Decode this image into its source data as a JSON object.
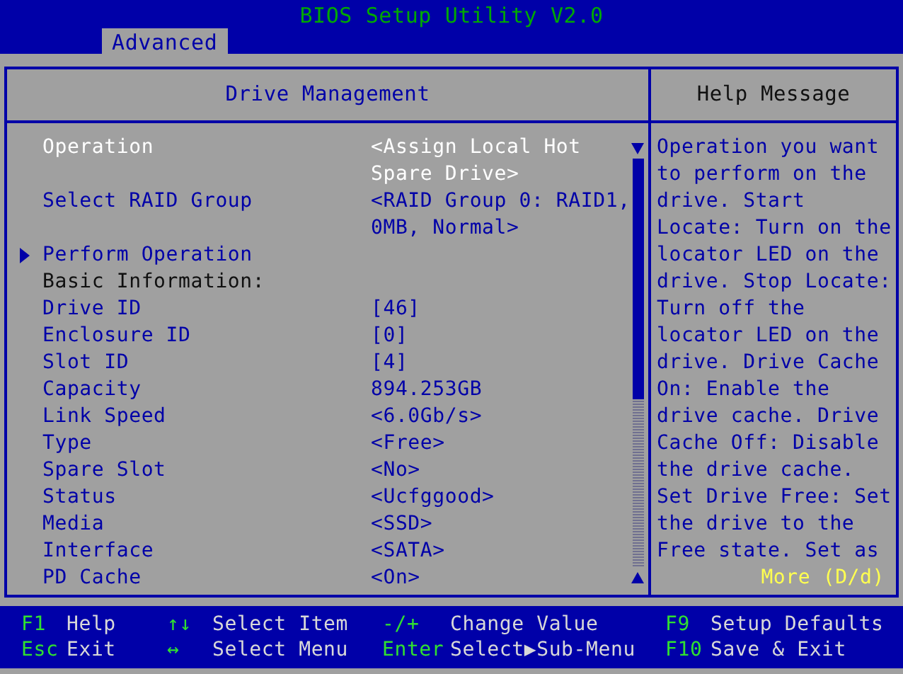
{
  "window": {
    "title": "BIOS Setup Utility V2.0"
  },
  "tabs": [
    {
      "label": "Advanced",
      "selected": true
    }
  ],
  "panel": {
    "title": "Drive Management",
    "items": [
      {
        "kind": "option",
        "label": "Operation",
        "value": [
          "<Assign Local Hot",
          "Spare Drive>"
        ],
        "selected": true
      },
      {
        "kind": "option",
        "label": "Select RAID Group",
        "value": [
          "<RAID Group 0: RAID1,",
          "0MB, Normal>"
        ],
        "selected": false
      },
      {
        "kind": "submenu",
        "label": "Perform Operation",
        "selected": false
      },
      {
        "kind": "heading",
        "label": "Basic Information:",
        "selected": false
      },
      {
        "kind": "option",
        "label": "Drive ID",
        "value": [
          "[46]"
        ],
        "selected": false
      },
      {
        "kind": "option",
        "label": "Enclosure ID",
        "value": [
          "[0]"
        ],
        "selected": false
      },
      {
        "kind": "option",
        "label": "Slot ID",
        "value": [
          "[4]"
        ],
        "selected": false
      },
      {
        "kind": "option",
        "label": "Capacity",
        "value": [
          "894.253GB"
        ],
        "selected": false
      },
      {
        "kind": "option",
        "label": "Link Speed",
        "value": [
          "<6.0Gb/s>"
        ],
        "selected": false
      },
      {
        "kind": "option",
        "label": "Type",
        "value": [
          "<Free>"
        ],
        "selected": false
      },
      {
        "kind": "option",
        "label": "Spare Slot",
        "value": [
          "<No>"
        ],
        "selected": false
      },
      {
        "kind": "option",
        "label": "Status",
        "value": [
          "<Ucfggood>"
        ],
        "selected": false
      },
      {
        "kind": "option",
        "label": "Media",
        "value": [
          "<SSD>"
        ],
        "selected": false
      },
      {
        "kind": "option",
        "label": "Interface",
        "value": [
          "<SATA>"
        ],
        "selected": false
      },
      {
        "kind": "option",
        "label": "PD Cache",
        "value": [
          "<On>"
        ],
        "selected": false
      }
    ]
  },
  "help": {
    "title": "Help Message",
    "lines": [
      "Operation you want",
      "to perform on the",
      "drive. Start",
      "Locate: Turn on the",
      "locator LED on the",
      "drive. Stop Locate:",
      "Turn off the",
      "locator LED on the",
      "drive. Drive Cache",
      "On: Enable the",
      "drive cache. Drive",
      "Cache Off: Disable",
      "the drive cache.",
      "Set Drive Free: Set",
      "the drive to the",
      "Free state. Set as"
    ],
    "more": "More (D/d)"
  },
  "status_bar": [
    {
      "key": "F1",
      "action": "Help"
    },
    {
      "key": "Esc",
      "action": "Exit"
    },
    {
      "key": "↑↓",
      "action": "Select Item"
    },
    {
      "key": "↔",
      "action": "Select Menu"
    },
    {
      "key": "-/+",
      "action": "Change Value"
    },
    {
      "key": "Enter",
      "action": "Select▶Sub-Menu"
    },
    {
      "key": "F9",
      "action": "Setup Defaults"
    },
    {
      "key": "F10",
      "action": "Save & Exit"
    }
  ]
}
